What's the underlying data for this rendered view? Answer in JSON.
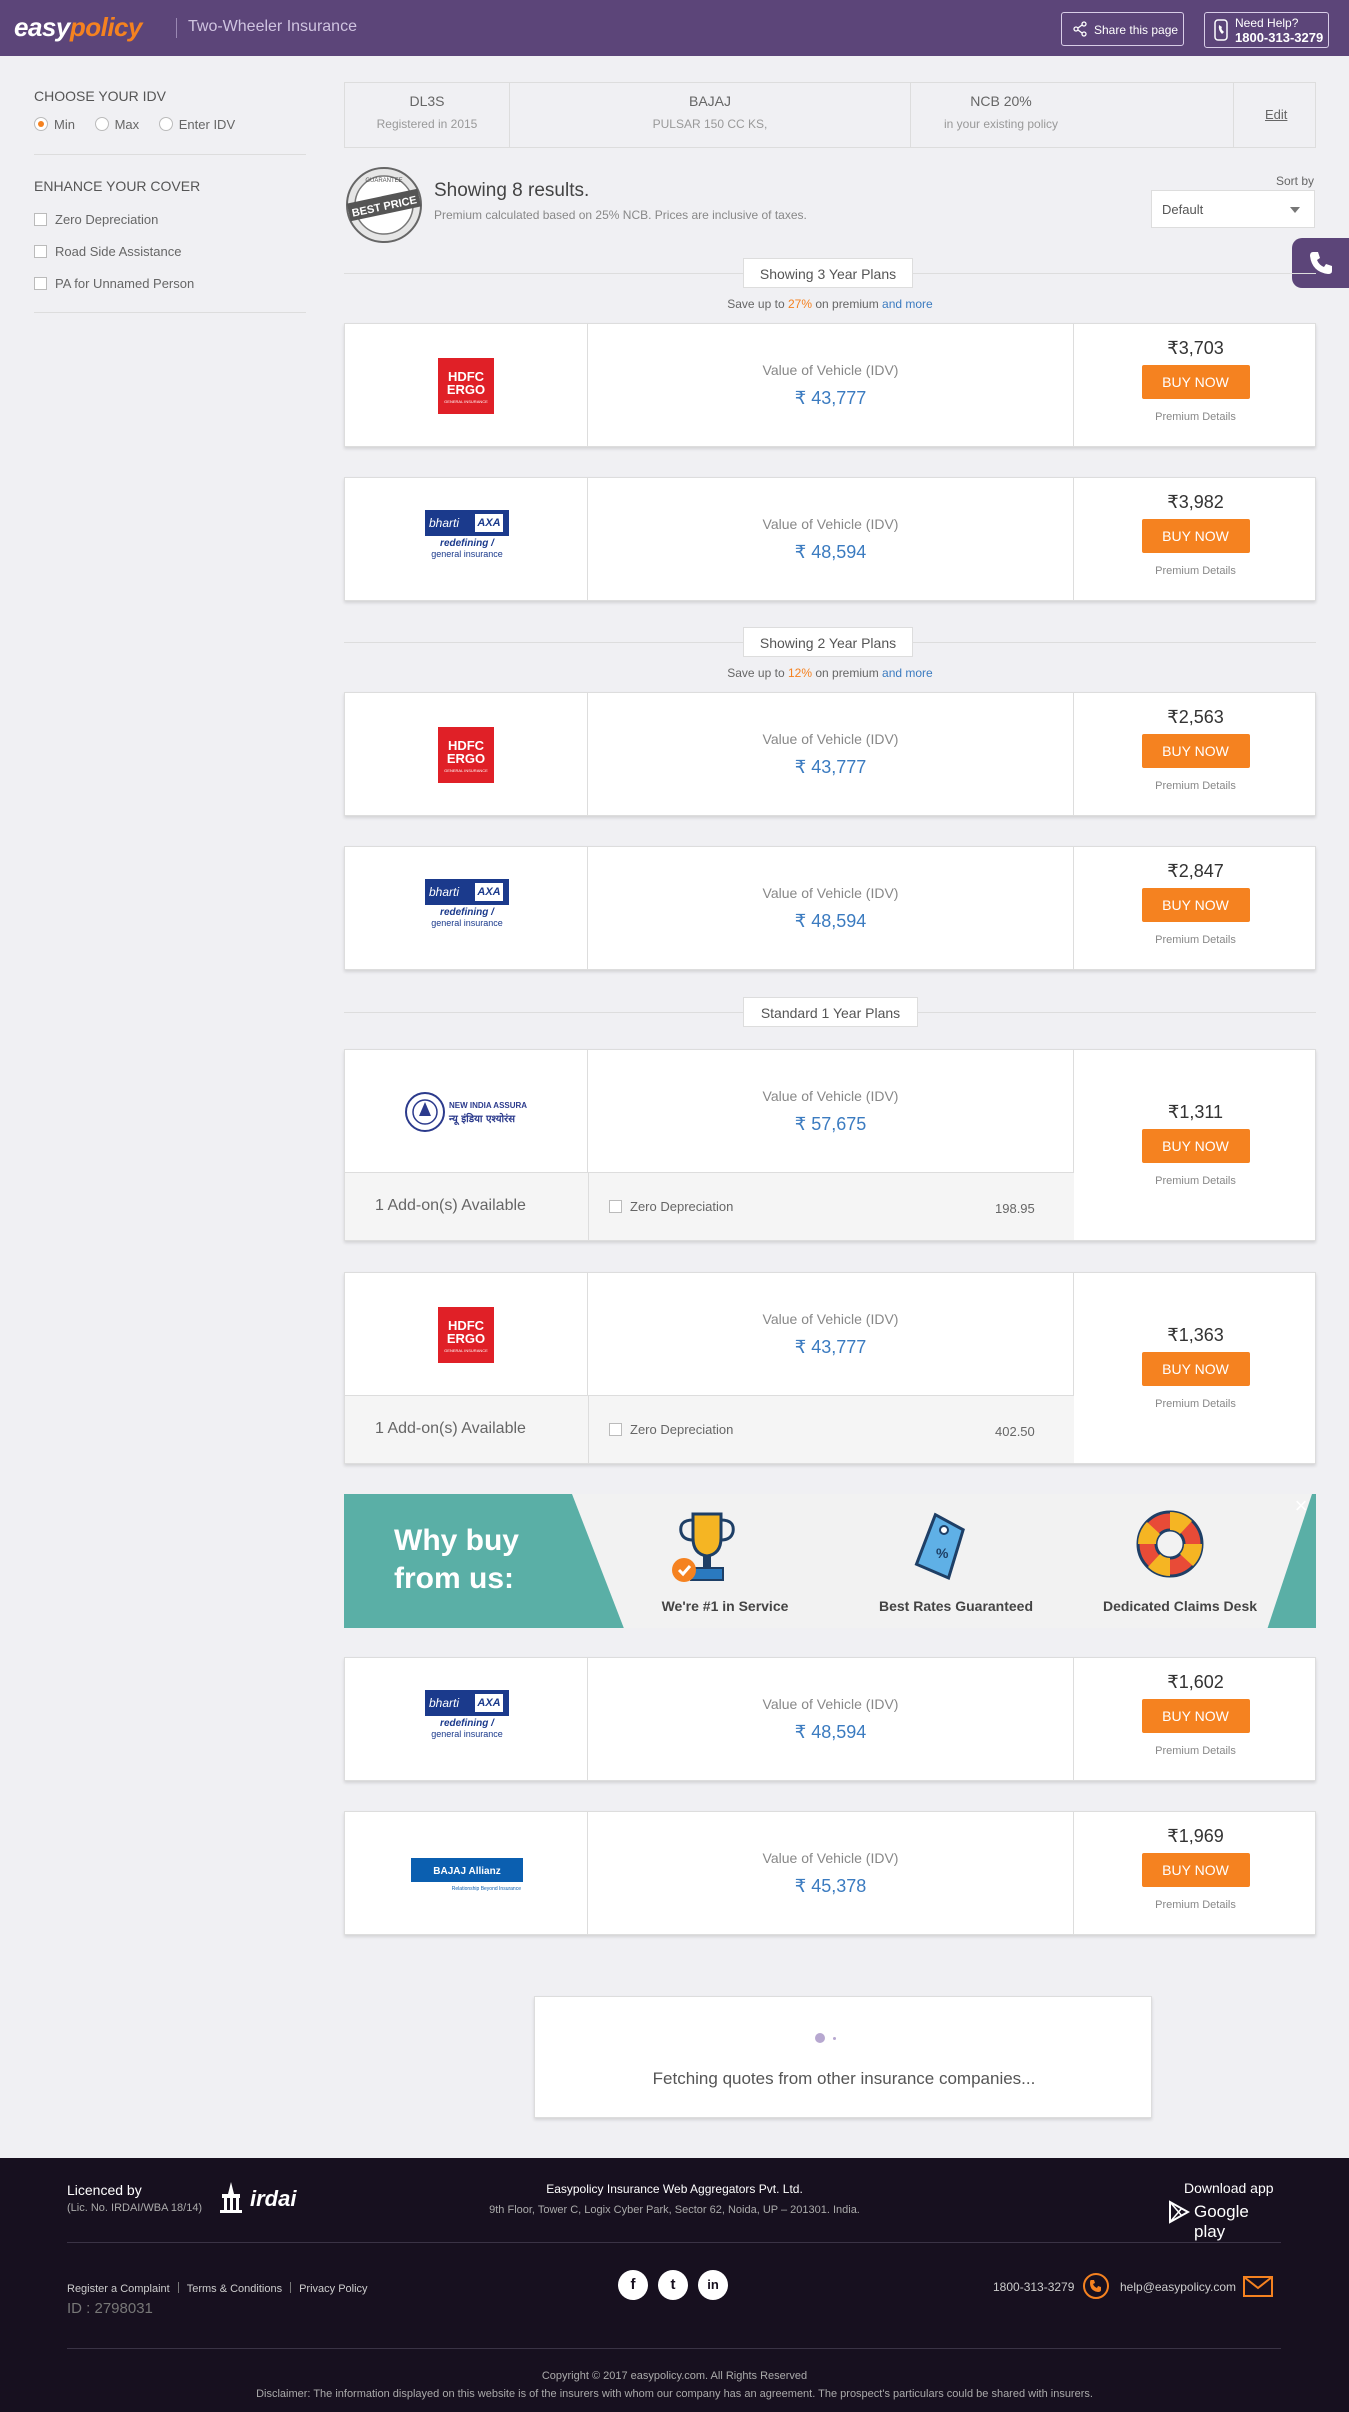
{
  "header": {
    "logo_part1": "easy",
    "logo_part2": "policy",
    "subtitle": "Two-Wheeler Insurance",
    "share_label": "Share this page",
    "help_label": "Need Help?",
    "help_phone": "1800-313-3279"
  },
  "sidebar": {
    "idv_title": "CHOOSE YOUR IDV",
    "idv_options": [
      "Min",
      "Max",
      "Enter IDV"
    ],
    "idv_selected": "Min",
    "cover_title": "ENHANCE YOUR COVER",
    "cover_options": [
      "Zero Depreciation",
      "Road Side Assistance",
      "PA for Unnamed Person"
    ]
  },
  "vehicle": {
    "reg": "DL3S",
    "reg_sub": "Registered in 2015",
    "make": "BAJAJ",
    "model": "PULSAR 150 CC KS,",
    "ncb": "NCB 20%",
    "ncb_sub": "in your existing policy",
    "edit_label": "Edit"
  },
  "results": {
    "badge_text": "BEST PRICE",
    "badge_ring": "GUARANTEE",
    "title": "Showing 8 results.",
    "subtitle": "Premium calculated based on 25% NCB. Prices are inclusive of taxes.",
    "sort_label": "Sort by",
    "sort_value": "Default"
  },
  "sections": [
    {
      "title": "Showing 3 Year Plans",
      "save_prefix": "Save up to ",
      "save_pct": "27%",
      "save_mid": " on premium ",
      "save_more": "and more"
    },
    {
      "title": "Showing 2 Year Plans",
      "save_prefix": "Save up to ",
      "save_pct": "12%",
      "save_mid": " on premium ",
      "save_more": "and more"
    },
    {
      "title": "Standard 1 Year Plans"
    }
  ],
  "common": {
    "idv_label": "Value of Vehicle (IDV)",
    "buy_label": "BUY NOW",
    "details_label": "Premium Details"
  },
  "plans": [
    {
      "insurer": "HDFC ERGO",
      "idv": "₹ 43,777",
      "price": "₹3,703"
    },
    {
      "insurer": "Bharti AXA",
      "idv": "₹ 48,594",
      "price": "₹3,982"
    },
    {
      "insurer": "HDFC ERGO",
      "idv": "₹ 43,777",
      "price": "₹2,563"
    },
    {
      "insurer": "Bharti AXA",
      "idv": "₹ 48,594",
      "price": "₹2,847"
    },
    {
      "insurer": "New India Assurance",
      "idv": "₹ 57,675",
      "price": "₹1,311",
      "addon_title": "1 Add-on(s) Available",
      "addon_name": "Zero Depreciation",
      "addon_price": "198.95"
    },
    {
      "insurer": "HDFC ERGO",
      "idv": "₹ 43,777",
      "price": "₹1,363",
      "addon_title": "1 Add-on(s) Available",
      "addon_name": "Zero Depreciation",
      "addon_price": "402.50"
    },
    {
      "insurer": "Bharti AXA",
      "idv": "₹ 48,594",
      "price": "₹1,602"
    },
    {
      "insurer": "Bajaj Allianz",
      "idv": "₹ 45,378",
      "price": "₹1,969"
    }
  ],
  "logos": {
    "hdfc_line1": "HDFC",
    "hdfc_line2": "ERGO",
    "hdfc_small": "GENERAL INSURANCE",
    "bharti_name": "bharti",
    "bharti_axa": "AXA",
    "bharti_tag1": "redefining /",
    "bharti_tag2": "general insurance",
    "nia_name": "NEW INDIA ASSURANCE",
    "nia_hindi": "न्यू इंडिया एश्योरंस",
    "bajaj_name": "BAJAJ Allianz",
    "bajaj_tag": "Relationship Beyond Insurance"
  },
  "why_buy": {
    "title": "Why buy from us:",
    "items": [
      "We're #1 in Service",
      "Best Rates Guaranteed",
      "Dedicated Claims Desk"
    ],
    "close": "×"
  },
  "loader": {
    "text": "Fetching quotes from other insurance companies..."
  },
  "footer": {
    "licensed": "Licenced by",
    "lic_no": "(Lic. No. IRDAI/WBA 18/14)",
    "irdai": "irdai",
    "company": "Easypolicy Insurance Web Aggregators Pvt. Ltd.",
    "address": "9th Floor, Tower C, Logix Cyber Park, Sector 62, Noida, UP – 201301. India.",
    "download": "Download app",
    "google_play": "Google play",
    "links": [
      "Register a Complaint",
      "Terms & Conditions",
      "Privacy Policy"
    ],
    "id": "ID : 2798031",
    "social": [
      "f",
      "t",
      "in"
    ],
    "phone": "1800-313-3279",
    "email": "help@easypolicy.com",
    "copyright": "Copyright © 2017 easypolicy.com. All Rights Reserved",
    "disclaimer": "Disclaimer: The information displayed on this website is of the insurers with whom our company has an agreement. The prospect's particulars could be shared with insurers."
  },
  "colors": {
    "header_bg": "#5c4579",
    "accent": "#f58220",
    "link": "#3b7bc0",
    "teal": "#5aafa6",
    "footer_bg": "#17101f"
  }
}
